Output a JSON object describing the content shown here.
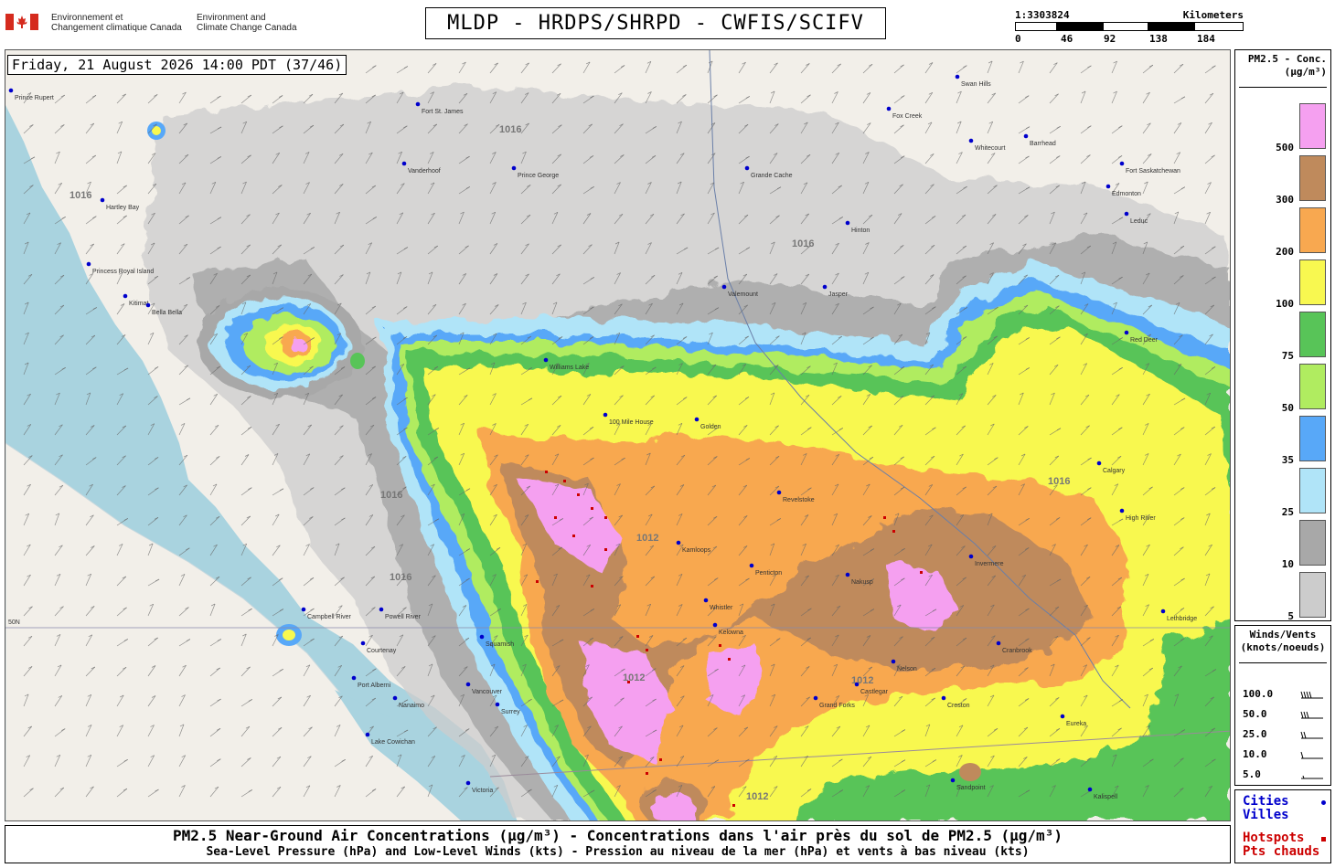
{
  "header": {
    "org_fr": [
      "Environnement et",
      "Changement climatique Canada"
    ],
    "org_en": [
      "Environment and",
      "Climate Change Canada"
    ],
    "title": "MLDP - HRDPS/SHRPD - CWFIS/SCIFV",
    "scale_ratio": "1:3303824",
    "scale_unit": "Kilometers",
    "scale_ticks": [
      "0",
      "46",
      "92",
      "138",
      "184"
    ]
  },
  "map": {
    "datetime": "Friday, 21 August 2026 14:00 PDT (37/46)",
    "isobar_labels": [
      "1016",
      "1012"
    ],
    "latitude_label": "50N",
    "places": [
      "Prince Rupert",
      "Fort St. James",
      "Vanderhoof",
      "Prince George",
      "Hartley Bay",
      "Princess Royal Island",
      "Kitimat",
      "Bella Bella",
      "Williams Lake",
      "100 Mile House",
      "Kamloops",
      "Vancouver",
      "Surrey",
      "Nanaimo",
      "Victoria",
      "Lake Cowichan",
      "Port Alberni",
      "Courtenay",
      "Campbell River",
      "Powell River",
      "Squamish",
      "Whistler",
      "Nakusp",
      "Cranbrook",
      "Calgary",
      "Edmonton",
      "Red Deer",
      "Jasper",
      "Valemount",
      "Grande Cache",
      "Hinton",
      "Fox Creek",
      "Swan Hills",
      "Whitecourt",
      "Barrhead",
      "Fort Saskatchewan",
      "Leduc",
      "High River",
      "Invermere",
      "Golden",
      "Revelstoke",
      "Kelowna",
      "Penticton",
      "Grand Forks",
      "Castlegar",
      "Nelson",
      "Creston",
      "Kalispell",
      "Sandpoint",
      "Eureka",
      "Lethbridge"
    ]
  },
  "pm_legend": {
    "title": [
      "PM2.5 - Conc.",
      "(µg/m³)"
    ],
    "levels": [
      {
        "label": "500",
        "color": "#f5a0f0"
      },
      {
        "label": "300",
        "color": "#bf8a5c"
      },
      {
        "label": "200",
        "color": "#f8a850"
      },
      {
        "label": "100",
        "color": "#f8f850"
      },
      {
        "label": "75",
        "color": "#58c458"
      },
      {
        "label": "50",
        "color": "#b0ec60"
      },
      {
        "label": "35",
        "color": "#58a8f8"
      },
      {
        "label": "25",
        "color": "#b0e4f8"
      },
      {
        "label": "10",
        "color": "#a8a8a8"
      },
      {
        "label": "5",
        "color": "#cccccc"
      }
    ]
  },
  "wind_legend": {
    "title": [
      "Winds/Vents",
      "(knots/noeuds)"
    ],
    "rows": [
      "100.0",
      "50.0",
      "25.0",
      "10.0",
      "5.0"
    ]
  },
  "point_legend": {
    "cities_en": "Cities",
    "cities_fr": "Villes",
    "cities_color": "#0000cc",
    "hotspots_en": "Hotspots",
    "hotspots_fr": "Pts chauds",
    "hotspots_color": "#cc0000"
  },
  "caption": {
    "line1": "PM2.5 Near-Ground Air Concentrations (µg/m³) - Concentrations dans l'air près du sol de PM2.5 (µg/m³)",
    "line2": "Sea-Level Pressure (hPa) and Low-Level Winds (kts) - Pression au niveau de la mer (hPa) et vents à bas niveau (kts)"
  }
}
